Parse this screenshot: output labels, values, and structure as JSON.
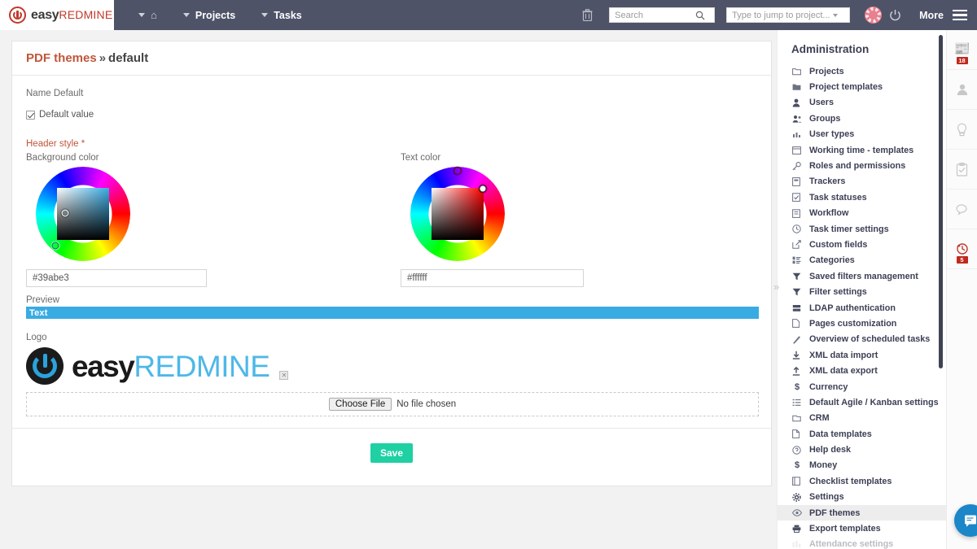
{
  "topbar": {
    "brand_easy": "easy",
    "brand_redmine": "REDMINE",
    "nav": [
      {
        "label": "",
        "icon": "home-icon",
        "has_chevron": true
      },
      {
        "label": "Projects",
        "icon": "",
        "has_chevron": true
      },
      {
        "label": "Tasks",
        "icon": "",
        "has_chevron": true
      }
    ],
    "trash_icon": "trash-icon",
    "search": {
      "value": "",
      "placeholder": "Search"
    },
    "jump": {
      "value": "",
      "placeholder": "Type to jump to project..."
    },
    "avatar": "user-avatar",
    "power_icon": "power-icon",
    "more_label": "More",
    "menu_icon": "hamburger-icon"
  },
  "page": {
    "breadcrumb_link": "PDF themes",
    "breadcrumb_sep": "»",
    "breadcrumb_current": "default",
    "name_row": "Name Default",
    "default_value_label": "Default value",
    "header_style_label": "Header style *",
    "background_color_label": "Background color",
    "background_color_value": "#39abe3",
    "text_color_label": "Text color",
    "text_color_value": "#ffffff",
    "preview_label": "Preview",
    "preview_text": "Text",
    "logo_label": "Logo",
    "logo_easy": "easy",
    "logo_redmine": "REDMINE",
    "choose_file_label": "Choose File",
    "no_file_label": "No file chosen",
    "save_label": "Save"
  },
  "colors": {
    "accent_blue": "#39abe3",
    "save_green": "#1fd0a3",
    "topbar": "#4f5368",
    "breadcrumb_link": "#c0563b",
    "badge_red": "#c0281c"
  },
  "admin": {
    "title": "Administration",
    "items": [
      {
        "label": "Projects",
        "icon": "folder-icon",
        "active": false
      },
      {
        "label": "Project templates",
        "icon": "folder-filled-icon",
        "active": false
      },
      {
        "label": "Users",
        "icon": "user-icon",
        "active": false
      },
      {
        "label": "Groups",
        "icon": "group-icon",
        "active": false
      },
      {
        "label": "User types",
        "icon": "user-types-icon",
        "active": false
      },
      {
        "label": "Working time - templates",
        "icon": "calendar-icon",
        "active": false
      },
      {
        "label": "Roles and permissions",
        "icon": "key-icon",
        "active": false
      },
      {
        "label": "Trackers",
        "icon": "tracker-icon",
        "active": false
      },
      {
        "label": "Task statuses",
        "icon": "checkbox-icon",
        "active": false
      },
      {
        "label": "Workflow",
        "icon": "workflow-icon",
        "active": false
      },
      {
        "label": "Task timer settings",
        "icon": "clock-icon",
        "active": false
      },
      {
        "label": "Custom fields",
        "icon": "edit-square-icon",
        "active": false
      },
      {
        "label": "Categories",
        "icon": "categories-icon",
        "active": false
      },
      {
        "label": "Saved filters management",
        "icon": "filter-icon",
        "active": false
      },
      {
        "label": "Filter settings",
        "icon": "filter-icon",
        "active": false
      },
      {
        "label": "LDAP authentication",
        "icon": "server-icon",
        "active": false
      },
      {
        "label": "Pages customization",
        "icon": "page-icon",
        "active": false
      },
      {
        "label": "Overview of scheduled tasks",
        "icon": "scheduled-icon",
        "active": false
      },
      {
        "label": "XML data import",
        "icon": "download-icon",
        "active": false
      },
      {
        "label": "XML data export",
        "icon": "upload-icon",
        "active": false
      },
      {
        "label": "Currency",
        "icon": "dollar-icon",
        "active": false
      },
      {
        "label": "Default Agile / Kanban settings",
        "icon": "list-icon",
        "active": false
      },
      {
        "label": "CRM",
        "icon": "crm-icon",
        "active": false
      },
      {
        "label": "Data templates",
        "icon": "file-icon",
        "active": false
      },
      {
        "label": "Help desk",
        "icon": "help-icon",
        "active": false
      },
      {
        "label": "Money",
        "icon": "dollar-icon",
        "active": false
      },
      {
        "label": "Checklist templates",
        "icon": "checklist-icon",
        "active": false
      },
      {
        "label": "Settings",
        "icon": "gear-icon",
        "active": false
      },
      {
        "label": "PDF themes",
        "icon": "eye-icon",
        "active": true
      },
      {
        "label": "Export templates",
        "icon": "printer-icon",
        "active": false
      },
      {
        "label": "Attendance settings",
        "icon": "attendance-icon",
        "active": false
      }
    ]
  },
  "rail": {
    "items": [
      {
        "icon": "news-icon",
        "badge": "18"
      },
      {
        "icon": "contacts-icon",
        "badge": ""
      },
      {
        "icon": "idea-icon",
        "badge": ""
      },
      {
        "icon": "tasks-clipboard-icon",
        "badge": ""
      },
      {
        "icon": "chat-history-icon",
        "badge": ""
      },
      {
        "icon": "time-history-icon",
        "badge": "5"
      }
    ],
    "chat_icon": "chat-widget-icon"
  }
}
